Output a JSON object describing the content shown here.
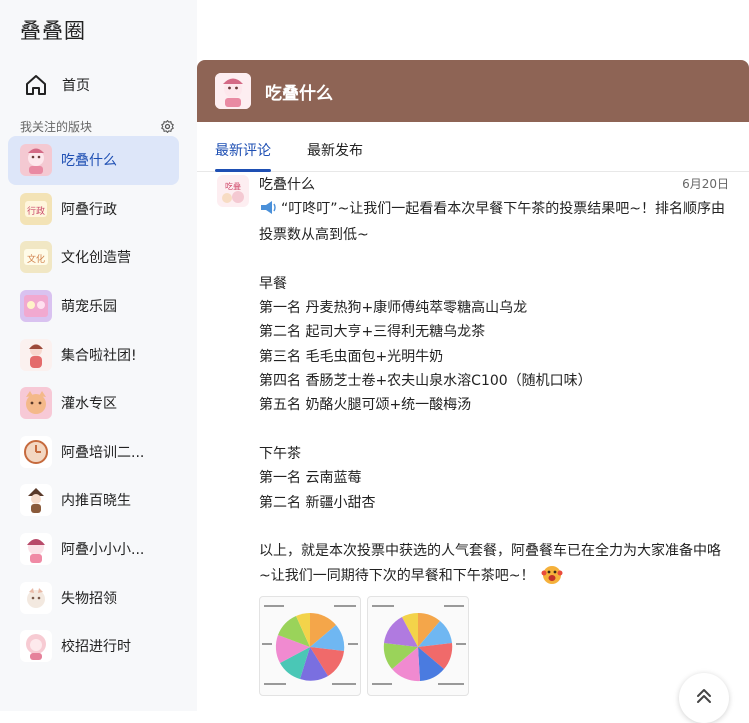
{
  "app": {
    "title": "叠叠圈"
  },
  "nav": {
    "home_label": "首页"
  },
  "sidebar": {
    "followed_label": "我关注的版块",
    "items": [
      {
        "label": "吃叠什么",
        "color": "#f4c9d2",
        "active": true
      },
      {
        "label": "阿叠行政",
        "color": "#f3e3b6",
        "active": false
      },
      {
        "label": "文化创造营",
        "color": "#f1e7c4",
        "active": false
      },
      {
        "label": "萌宠乐园",
        "color": "#d9c2f0",
        "active": false
      },
      {
        "label": "集合啦社团!",
        "color": "#f3d0cc",
        "active": false
      },
      {
        "label": "灌水专区",
        "color": "#f7c9d6",
        "active": false
      },
      {
        "label": "阿叠培训二...",
        "color": "#f3d7c2",
        "active": false
      },
      {
        "label": "内推百晓生",
        "color": "#e2d4c6",
        "active": false
      },
      {
        "label": "阿叠小小小...",
        "color": "#f6d3dd",
        "active": false
      },
      {
        "label": "失物招领",
        "color": "#f3e9e0",
        "active": false
      },
      {
        "label": "校招进行时",
        "color": "#f7cbd3",
        "active": false
      }
    ]
  },
  "board": {
    "title": "吃叠什么",
    "header_color": "#8e6455"
  },
  "tabs": [
    {
      "label": "最新评论",
      "active": true
    },
    {
      "label": "最新发布",
      "active": false
    }
  ],
  "post": {
    "author": "吃叠什么",
    "date": "6月20日",
    "intro": "“叮咚叮”~让我们一起看看本次早餐下午茶的投票结果吧~！排名顺序由投票数从高到低~",
    "breakfast_title": "早餐",
    "breakfast": [
      "第一名 丹麦热狗+康师傅纯萃零糖高山乌龙",
      "第二名 起司大亨+三得利无糖乌龙茶",
      "第三名 毛毛虫面包+光明牛奶",
      "第四名 香肠芝士卷+农夫山泉水溶C100（随机口味）",
      "第五名 奶酪火腿可颂+统一酸梅汤"
    ],
    "tea_title": "下午茶",
    "tea": [
      "第一名 云南蓝莓",
      "第二名 新疆小甜杏"
    ],
    "outro": "以上，就是本次投票中获选的人气套餐，阿叠餐车已在全力为大家准备中咯~让我们一同期待下次的早餐和下午茶吧~！",
    "icons": {
      "megaphone": "megaphone-icon",
      "emoji": "excited-face-icon"
    }
  },
  "accent": "#1e4fb3"
}
